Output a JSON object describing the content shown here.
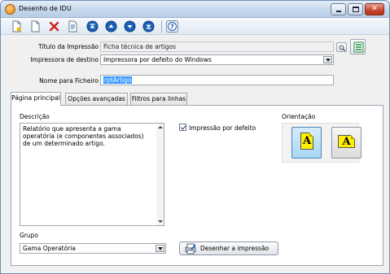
{
  "window": {
    "title": "Desenho de IDU"
  },
  "form": {
    "title_label": "Título da Impressão",
    "title_value": "Ficha técnica de artigos",
    "printer_label": "Impressora de destino",
    "printer_value": "Impressora por defeito do Windows",
    "filename_label": "Nome para Ficheiro",
    "filename_value": "rptArtigo"
  },
  "tabs": [
    {
      "label": "Página principal"
    },
    {
      "label": "Opções avançadas"
    },
    {
      "label": "Filtros para linhas"
    }
  ],
  "main": {
    "description_label": "Descrição",
    "description_text": "Relatório que apresenta a gama operatória (e componentes associados) de um determinado artigo.",
    "default_print_label": "Impressão por defeito",
    "default_print_checked": true,
    "orientation_label": "Orientação",
    "portrait_glyph": "A",
    "landscape_glyph": "A",
    "group_label": "Grupo",
    "group_value": "Gama Operatória",
    "draw_button_label": "Desenhar a impressão"
  },
  "colors": {
    "titlebar": "#c7d8ec",
    "toolbar_icon": "#1b5fb5",
    "close": "#c7442c",
    "selection": "#3399ff",
    "page_icon": "#ffef00"
  }
}
